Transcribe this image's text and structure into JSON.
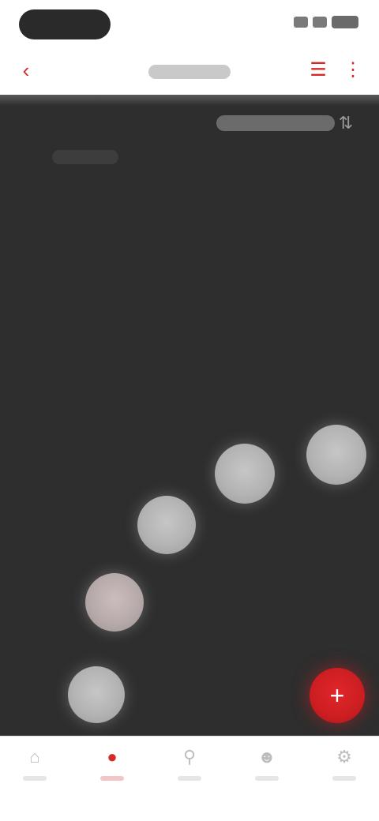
{
  "colors": {
    "accent": "#d42a2a",
    "content_bg": "#2e2e2e",
    "bubble": "#bdbdbd",
    "fab": "#d01f24"
  },
  "icons": {
    "nav_left": "back-icon",
    "nav_right_1": "filter-icon",
    "nav_right_2": "more-icon",
    "top_right": "sort-icon",
    "fab": "add-icon",
    "tabs": [
      "home-icon",
      "bubbles-icon",
      "search-icon",
      "profile-icon",
      "settings-icon"
    ]
  },
  "tabs": [
    {
      "id": "tab-1",
      "active": false
    },
    {
      "id": "tab-2",
      "active": true
    },
    {
      "id": "tab-3",
      "active": false
    },
    {
      "id": "tab-4",
      "active": false
    },
    {
      "id": "tab-5",
      "active": false
    }
  ]
}
